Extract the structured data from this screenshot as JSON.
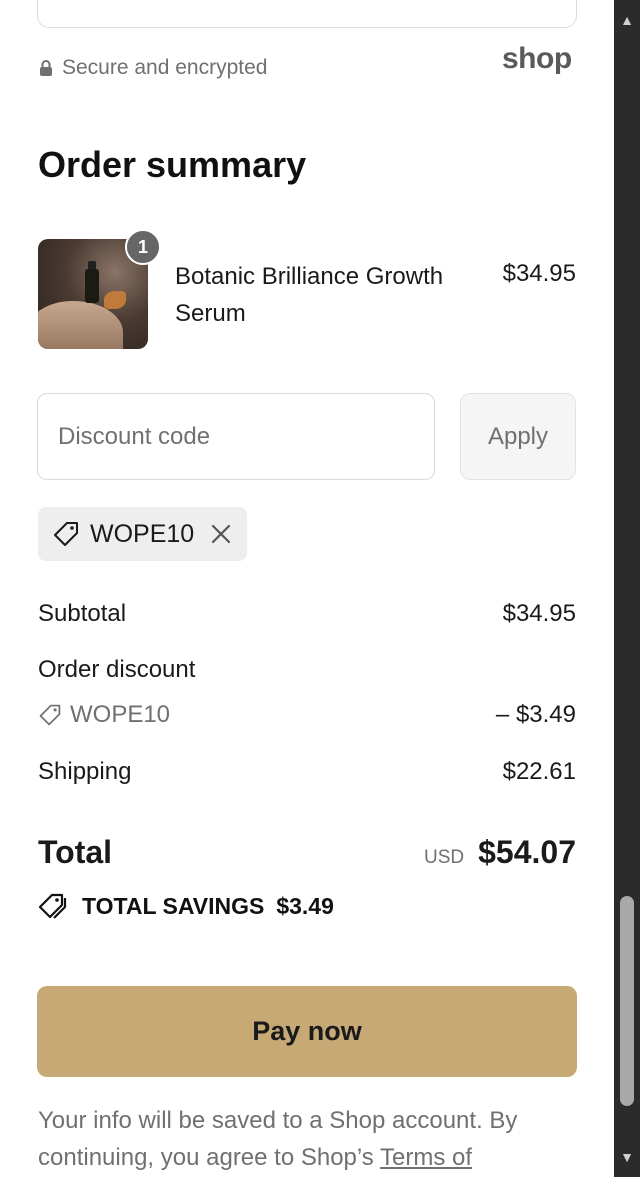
{
  "header": {
    "secure_text": "Secure and encrypted",
    "shop_logo": "shop"
  },
  "order_summary": {
    "title": "Order summary",
    "item": {
      "quantity": "1",
      "name": "Botanic Brilliance Growth Serum",
      "price": "$34.95"
    }
  },
  "discount": {
    "placeholder": "Discount code",
    "apply_label": "Apply",
    "applied_code": "WOPE10"
  },
  "totals": {
    "subtotal_label": "Subtotal",
    "subtotal_value": "$34.95",
    "order_discount_label": "Order discount",
    "discount_code": "WOPE10",
    "discount_value": "– $3.49",
    "shipping_label": "Shipping",
    "shipping_value": "$22.61",
    "total_label": "Total",
    "currency": "USD",
    "total_value": "$54.07",
    "savings_label": "TOTAL SAVINGS",
    "savings_value": "$3.49"
  },
  "actions": {
    "pay_now": "Pay now"
  },
  "footer": {
    "text": "Your info will be saved to a Shop account. By continuing, you agree to Shop’s",
    "link": "Terms of"
  },
  "colors": {
    "pay_button": "#c6a974",
    "muted_text": "#707070",
    "scrollbar_bg": "#2b2b2b"
  }
}
